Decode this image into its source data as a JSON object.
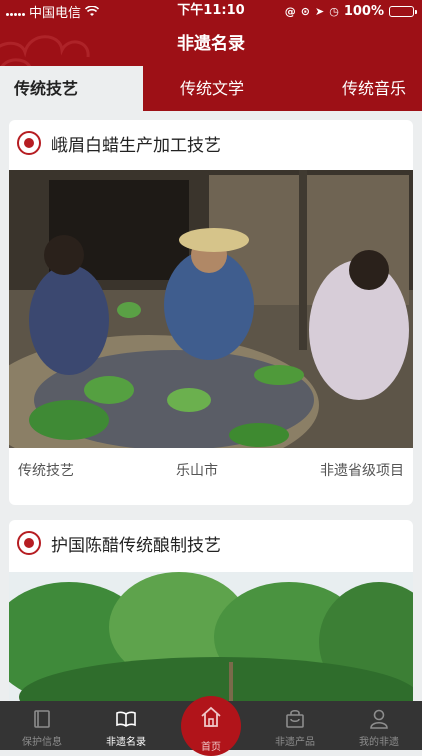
{
  "status": {
    "carrier": "中国电信",
    "time": "下午11:10",
    "battery": "100%"
  },
  "header": {
    "title": "非遗名录"
  },
  "tabs": [
    {
      "label": "传统技艺",
      "active": true
    },
    {
      "label": "传统文学",
      "active": false
    },
    {
      "label": "传统音乐",
      "active": false
    }
  ],
  "cards": [
    {
      "title": "峨眉白蜡生产加工技艺",
      "category": "传统技艺",
      "location": "乐山市",
      "level": "非遗省级项目"
    },
    {
      "title": "护国陈醋传统酿制技艺"
    }
  ],
  "tabbar": [
    {
      "label": "保护信息",
      "icon": "book-icon"
    },
    {
      "label": "非遗名录",
      "icon": "open-book-icon",
      "active": true
    },
    {
      "label": "首页",
      "icon": "home-icon"
    },
    {
      "label": "非遗产品",
      "icon": "shopping-bag-icon"
    },
    {
      "label": "我的非遗",
      "icon": "user-icon"
    }
  ],
  "colors": {
    "brand": "#9d1016",
    "background": "#eceeef",
    "tabbar": "#343434",
    "home_accent": "#b1141a"
  }
}
